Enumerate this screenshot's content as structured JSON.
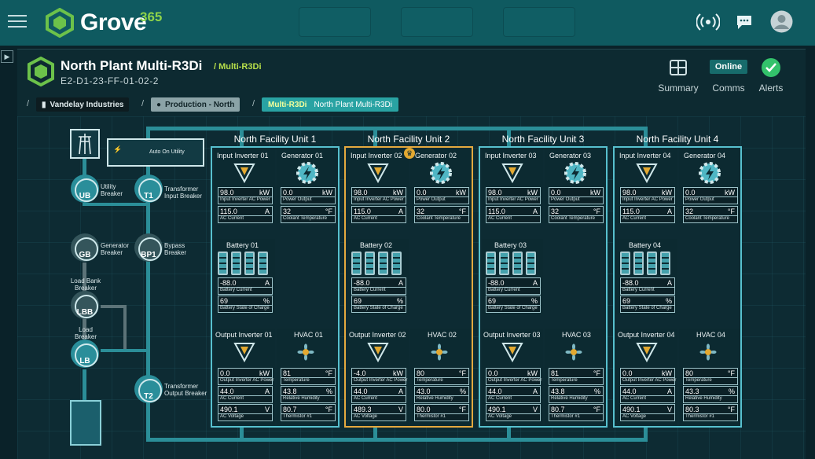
{
  "app": {
    "brand": "Grove",
    "brand_sup": "365"
  },
  "device": {
    "title": "North Plant Multi-R3Di",
    "subtitle": "/ Multi-R3Di",
    "id": "E2-D1-23-FF-01-02-2",
    "status": "Online"
  },
  "header_buttons": {
    "summary": "Summary",
    "comms": "Comms",
    "alerts": "Alerts"
  },
  "breadcrumb": {
    "org": "Vandelay Industries",
    "site": "Production - North",
    "device_model": "Multi-R3Di",
    "device_name": "North Plant Multi-R3Di",
    "sep": "/"
  },
  "diagram": {
    "auto_on_utility": "Auto On Utility",
    "nodes": [
      {
        "code": "UB",
        "label": "Utility\nBreaker"
      },
      {
        "code": "T1",
        "label": "Transformer\nInput Breaker"
      },
      {
        "code": "GB",
        "label": "Generator\nBreaker"
      },
      {
        "code": "BP1",
        "label": "Bypass\nBreaker"
      },
      {
        "code": "LBB",
        "label": "Load Bank\nBreaker"
      },
      {
        "code": "LB",
        "label": "Load\nBreaker"
      },
      {
        "code": "T2",
        "label": "Transformer\nOutput Breaker"
      }
    ],
    "units": [
      {
        "title": "North Facility Unit 1",
        "ii": "Input Inverter 01",
        "gen": "Generator 01",
        "bat": "Battery 01",
        "oi": "Output Inverter 01",
        "hvac": "HVAC 01",
        "ii_power": "98.0",
        "ii_cur": "115.0",
        "gen_power": "0.0",
        "gen_temp": "32",
        "bat_cur": "-88.0",
        "bat_soc": "69",
        "oi_power": "0.0",
        "oi_cur": "44.0",
        "oi_volt": "490.1",
        "hvac_temp": "81",
        "hvac_rh": "43.8",
        "hvac_th": "80.7"
      },
      {
        "title": "North Facility Unit 2",
        "ii": "Input Inverter 02",
        "gen": "Generator 02",
        "bat": "Battery 02",
        "oi": "Output Inverter 02",
        "hvac": "HVAC 02",
        "ii_power": "98.0",
        "ii_cur": "115.0",
        "gen_power": "0.0",
        "gen_temp": "32",
        "bat_cur": "-88.0",
        "bat_soc": "69",
        "oi_power": "-4.0",
        "oi_cur": "44.0",
        "oi_volt": "489.3",
        "hvac_temp": "80",
        "hvac_rh": "43.0",
        "hvac_th": "80.0"
      },
      {
        "title": "North Facility Unit 3",
        "ii": "Input Inverter 03",
        "gen": "Generator 03",
        "bat": "Battery 03",
        "oi": "Output Inverter 03",
        "hvac": "HVAC 03",
        "ii_power": "98.0",
        "ii_cur": "115.0",
        "gen_power": "0.0",
        "gen_temp": "32",
        "bat_cur": "-88.0",
        "bat_soc": "69",
        "oi_power": "0.0",
        "oi_cur": "44.0",
        "oi_volt": "490.1",
        "hvac_temp": "81",
        "hvac_rh": "43.8",
        "hvac_th": "80.7"
      },
      {
        "title": "North Facility Unit 4",
        "ii": "Input Inverter 04",
        "gen": "Generator 04",
        "bat": "Battery 04",
        "oi": "Output Inverter 04",
        "hvac": "HVAC 04",
        "ii_power": "98.0",
        "ii_cur": "115.0",
        "gen_power": "0.0",
        "gen_temp": "32",
        "bat_cur": "-88.0",
        "bat_soc": "69",
        "oi_power": "0.0",
        "oi_cur": "44.0",
        "oi_volt": "490.1",
        "hvac_temp": "80",
        "hvac_rh": "43.3",
        "hvac_th": "80.3"
      }
    ],
    "metric_labels": {
      "ii_power": "Input Inverter AC Power",
      "ac_current": "AC Current",
      "gen_power": "Power Output",
      "gen_temp": "Coolant Temperature",
      "bat_cur": "Battery Current",
      "bat_soc": "Battery State of Charge",
      "oi_power": "Output Inverter AC Power",
      "ac_voltage": "AC Voltage",
      "temp": "Temperature",
      "rh": "Relative Humidity",
      "th": "Thermistor #1"
    },
    "units_label": {
      "kw": "kW",
      "a": "A",
      "f": "°F",
      "pct": "%",
      "v": "V"
    }
  },
  "colors": {
    "topbar": "#0f5a60",
    "accent": "#2b8e98",
    "selected": "#e5a93f",
    "online": "#176b6b",
    "alert_ok": "#33c26b"
  }
}
